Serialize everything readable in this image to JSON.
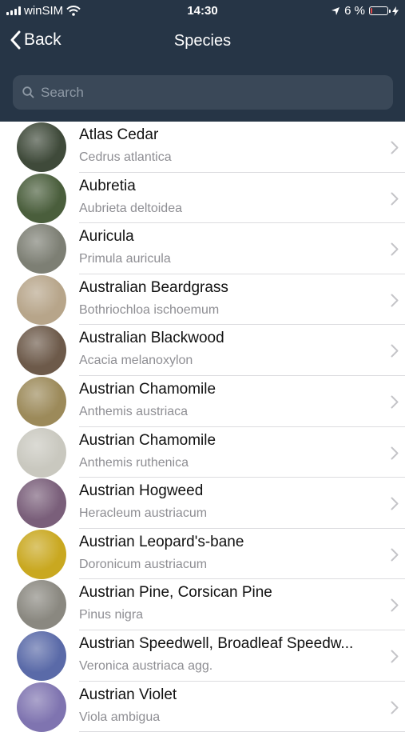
{
  "status_bar": {
    "carrier": "winSIM",
    "time": "14:30",
    "battery": "6 %"
  },
  "nav": {
    "back_label": "Back",
    "title": "Species"
  },
  "search": {
    "placeholder": "Search"
  },
  "species": [
    {
      "name": "Atlas Cedar",
      "scientific": "Cedrus atlantica",
      "thumb": "#3f4a3a"
    },
    {
      "name": "Aubretia",
      "scientific": "Aubrieta deltoidea",
      "thumb": "#4a5e3c"
    },
    {
      "name": "Auricula",
      "scientific": "Primula auricula",
      "thumb": "#7d7f74"
    },
    {
      "name": "Australian Beardgrass",
      "scientific": "Bothriochloa ischoemum",
      "thumb": "#b7a58a"
    },
    {
      "name": "Australian Blackwood",
      "scientific": "Acacia melanoxylon",
      "thumb": "#6d5a4a"
    },
    {
      "name": "Austrian Chamomile",
      "scientific": "Anthemis austriaca",
      "thumb": "#9c8a5a"
    },
    {
      "name": "Austrian Chamomile",
      "scientific": "Anthemis ruthenica",
      "thumb": "#c9c8bf"
    },
    {
      "name": "Austrian Hogweed",
      "scientific": "Heracleum austriacum",
      "thumb": "#7a5f7a"
    },
    {
      "name": "Austrian Leopard's-bane",
      "scientific": "Doronicum austriacum",
      "thumb": "#c9a820"
    },
    {
      "name": "Austrian Pine, Corsican Pine",
      "scientific": "Pinus nigra",
      "thumb": "#8a8880"
    },
    {
      "name": "Austrian Speedwell, Broadleaf Speedw...",
      "scientific": "Veronica austriaca agg.",
      "thumb": "#5a6aa8"
    },
    {
      "name": "Austrian Violet",
      "scientific": "Viola ambigua",
      "thumb": "#7f74b0"
    }
  ]
}
